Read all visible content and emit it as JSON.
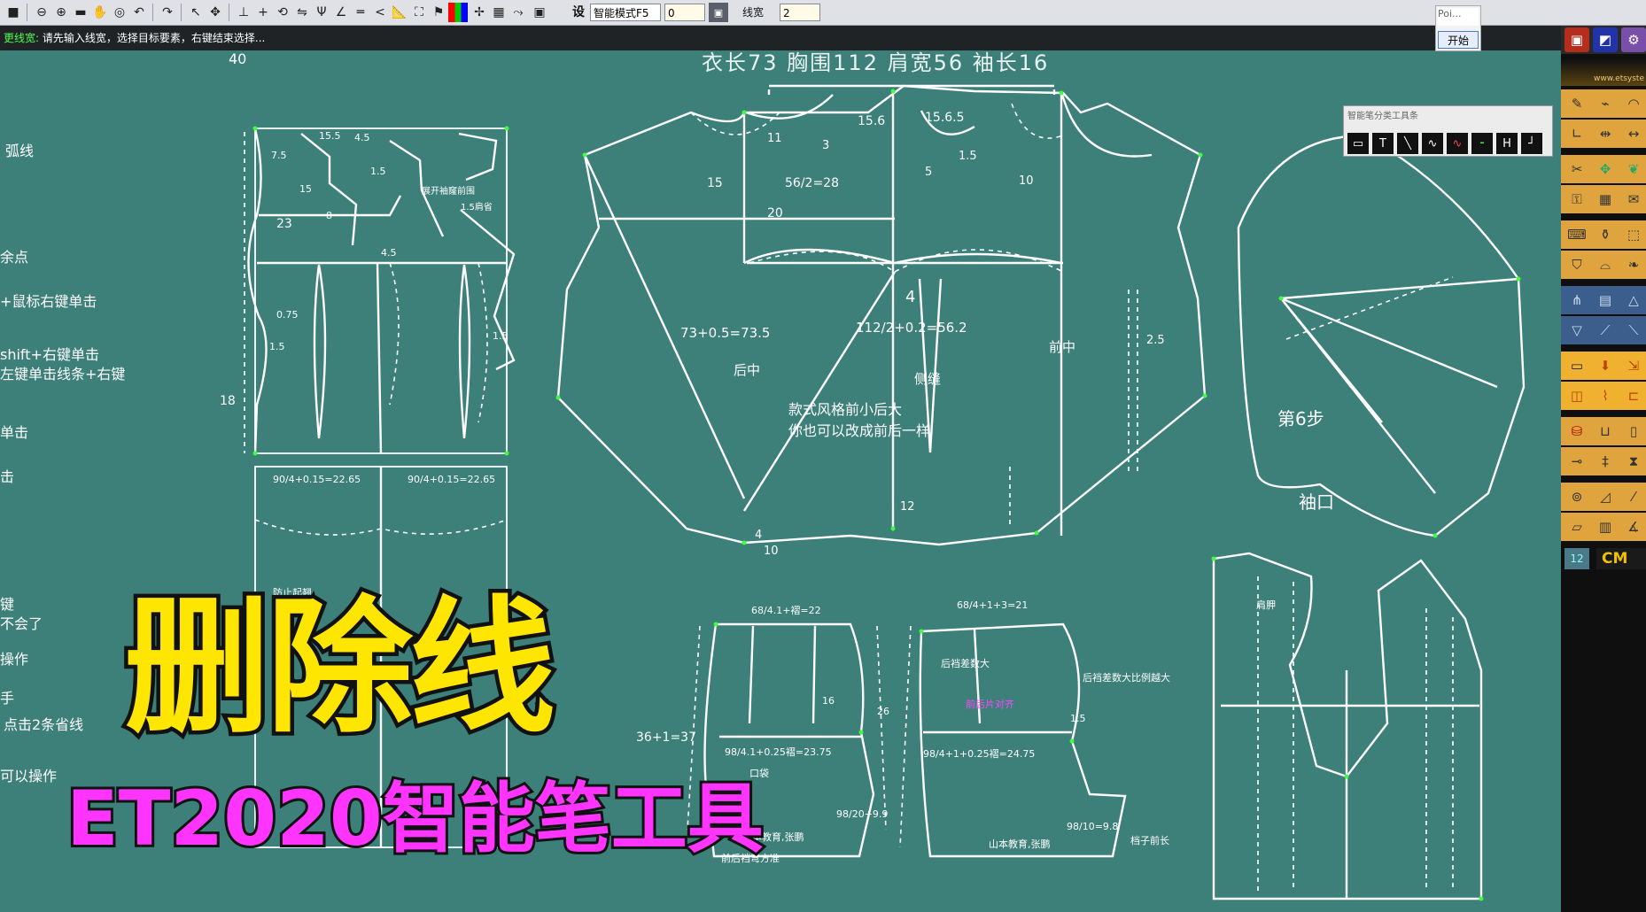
{
  "toolbar": {
    "icons": [
      "save-icon",
      "zoom-out-icon",
      "zoom-in-icon",
      "window-icon",
      "hand-icon",
      "zoom-area-icon",
      "undo-icon",
      "redo-icon",
      "select-icon",
      "move-icon",
      "straight-line-icon",
      "cross-icon",
      "rotate-icon",
      "mirror-icon",
      "fork-icon",
      "angle-icon",
      "parallel-icon",
      "arrow-icon",
      "ruler-icon",
      "measure-icon",
      "color-icon",
      "pin-icon",
      "flip-icon",
      "curve-icon",
      "grid-icon"
    ],
    "set_label": "设",
    "mode_select": "智能模式F5",
    "value_field": "0",
    "line_width_label": "线宽",
    "line_width_value": "2"
  },
  "prompt": {
    "label": "更线宽:",
    "text": "请先输入线宽，选择目标要素，右键结束选择..."
  },
  "mini_widget": {
    "value": "Poi...",
    "start_button": "开始"
  },
  "floating_toolbar": {
    "title": "智能笔分类工具条",
    "tools": [
      "rect-tool-icon",
      "text-tool-icon",
      "line-tool-icon",
      "curve-tool-icon",
      "wave-tool-icon",
      "dash-tool-icon",
      "h-tool-icon",
      "corner-tool-icon"
    ],
    "tool_glyphs": [
      "▭",
      "T",
      "╲",
      "∿",
      "∿",
      "⁃",
      "H",
      "┘"
    ]
  },
  "header_measure": "衣长73  胸围112  肩宽56  袖长16",
  "left_help": [
    "弧线",
    "余点",
    "+鼠标右键单击",
    "shift+右键单击",
    "左键单击线条+右键",
    "单击",
    "击",
    "键",
    "不会了",
    "操作",
    "手",
    "点击2条省线",
    "可以操作"
  ],
  "pattern_labels": {
    "back_top": [
      "15.5",
      "4.5",
      "7.5",
      "15",
      "1.5",
      "23",
      "8",
      "4.5",
      "40",
      "0.75",
      "1.5",
      "18",
      "1.5",
      "展开袖窿前围",
      "1.5肩省"
    ],
    "front_top": [
      "11",
      "3",
      "15",
      "56/2=28",
      "20",
      "15.6",
      "15.6.5",
      "1.5",
      "5",
      "10",
      "73+0.5=73.5",
      "112/2+0.2=56.2",
      "后中",
      "前中",
      "侧缝",
      "4",
      "2.5",
      "12",
      "4",
      "10"
    ],
    "note_text": [
      "款式风格前小后大",
      "你也可以改成前后一样"
    ],
    "sleeve": [
      "第6步",
      "袖口"
    ],
    "lower_left": [
      "90/4+0.15=22.65",
      "90/4+0.15=22.65",
      "防止起翘"
    ],
    "lower_mid": [
      "68/4.1+褶=22",
      "36+1=37",
      "98/4.1+0.25褶=23.75",
      "口袋",
      "98/20+9.9",
      "16",
      "26",
      "山本教育,张鹏",
      "前后裆弯方准"
    ],
    "lower_mid2": [
      "68/4+1+3=21",
      "后裆差数大",
      "98/4+1+0.25褶=24.75",
      "98/10=9.8",
      "山本教育,张鹏",
      "后裆差数大比例越大",
      "1.5",
      "档子前长",
      "前后片对齐"
    ],
    "right_bottom": [
      "肩胛"
    ]
  },
  "right_panel": {
    "site": "www.etsyste",
    "badge": "12",
    "unit": "CM"
  },
  "overlay": {
    "title": "删除线",
    "subtitle": "ET2020智能笔工具"
  }
}
